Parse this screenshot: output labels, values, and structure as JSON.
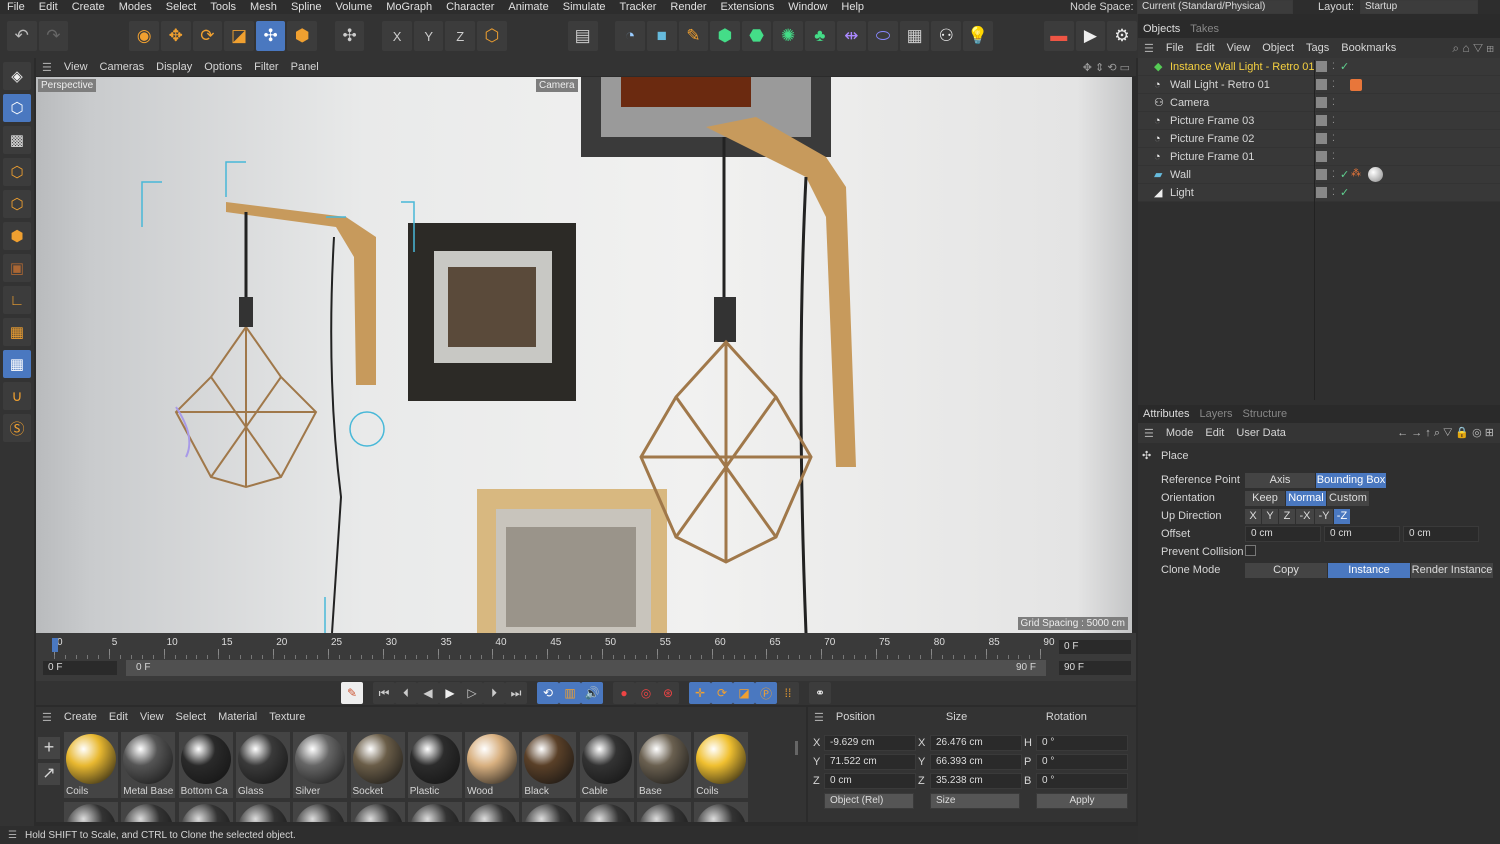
{
  "menu": [
    "File",
    "Edit",
    "Create",
    "Modes",
    "Select",
    "Tools",
    "Mesh",
    "Spline",
    "Volume",
    "MoGraph",
    "Character",
    "Animate",
    "Simulate",
    "Tracker",
    "Render",
    "Extensions",
    "Window",
    "Help"
  ],
  "node_space": {
    "label": "Node Space:",
    "value": "Current (Standard/Physical)"
  },
  "layout": {
    "label": "Layout:",
    "value": "Startup"
  },
  "viewport": {
    "menu": [
      "View",
      "Cameras",
      "Display",
      "Options",
      "Filter",
      "Panel"
    ],
    "view_name": "Perspective",
    "camera_label": "Camera",
    "grid_spacing": "Grid Spacing : 5000 cm"
  },
  "timeline": {
    "ticks": [
      "0",
      "5",
      "10",
      "15",
      "20",
      "25",
      "30",
      "35",
      "40",
      "45",
      "50",
      "55",
      "60",
      "65",
      "70",
      "75",
      "80",
      "85",
      "90"
    ],
    "current": "0 F",
    "start": "0 F",
    "range_start": "0 F",
    "range_end": "90 F",
    "end": "90 F"
  },
  "materials": {
    "menu": [
      "Create",
      "Edit",
      "View",
      "Select",
      "Material",
      "Texture"
    ],
    "items": [
      {
        "name": "Coils",
        "color": "#e8b830"
      },
      {
        "name": "Metal Base",
        "color": "#555"
      },
      {
        "name": "Bottom Ca",
        "color": "#2a2a2a"
      },
      {
        "name": "Glass",
        "color": "#3a3a3a"
      },
      {
        "name": "Silver",
        "color": "#666"
      },
      {
        "name": "Socket",
        "color": "#6a5d48"
      },
      {
        "name": "Plastic",
        "color": "#2c2c2c"
      },
      {
        "name": "Wood",
        "color": "#d8b080"
      },
      {
        "name": "Black",
        "color": "#5a4028"
      },
      {
        "name": "Cable",
        "color": "#333"
      },
      {
        "name": "Base",
        "color": "#6a6050"
      },
      {
        "name": "Coils",
        "color": "#f0c030"
      }
    ]
  },
  "coords": {
    "headers": [
      "Position",
      "Size",
      "Rotation"
    ],
    "rows": [
      {
        "a": "X",
        "p": "-9.629 cm",
        "b": "X",
        "s": "26.476 cm",
        "c": "H",
        "r": "0 °"
      },
      {
        "a": "Y",
        "p": "71.522 cm",
        "b": "Y",
        "s": "66.393 cm",
        "c": "P",
        "r": "0 °"
      },
      {
        "a": "Z",
        "p": "0 cm",
        "b": "Z",
        "s": "35.238 cm",
        "c": "B",
        "r": "0 °"
      }
    ],
    "mode": "Object (Rel)",
    "size_mode": "Size",
    "apply": "Apply"
  },
  "status": "Hold SHIFT to Scale, and CTRL to Clone the selected object.",
  "objects": {
    "tabs": [
      "Objects",
      "Takes"
    ],
    "menu": [
      "File",
      "Edit",
      "View",
      "Object",
      "Tags",
      "Bookmarks"
    ],
    "items": [
      {
        "name": "Instance Wall Light - Retro 01",
        "icon": "instance-icon",
        "selected": true
      },
      {
        "name": "Wall Light - Retro 01",
        "icon": "null-icon"
      },
      {
        "name": "Camera",
        "icon": "camera-icon"
      },
      {
        "name": "Picture Frame 03",
        "icon": "null-icon"
      },
      {
        "name": "Picture Frame 02",
        "icon": "null-icon"
      },
      {
        "name": "Picture Frame 01",
        "icon": "null-icon"
      },
      {
        "name": "Wall",
        "icon": "plane-icon"
      },
      {
        "name": "Light",
        "icon": "light-icon"
      }
    ]
  },
  "attributes": {
    "tabs": [
      "Attributes",
      "Layers",
      "Structure"
    ],
    "menu": [
      "Mode",
      "Edit",
      "User Data"
    ],
    "section": "Place",
    "reference_point": {
      "label": "Reference Point",
      "options": [
        "Axis",
        "Bounding Box"
      ],
      "selected": "Bounding Box"
    },
    "orientation": {
      "label": "Orientation",
      "options": [
        "Keep",
        "Normal",
        "Custom"
      ],
      "selected": "Normal"
    },
    "up_direction": {
      "label": "Up Direction",
      "options": [
        "X",
        "Y",
        "Z",
        "-X",
        "-Y",
        "-Z"
      ],
      "selected": "-Z"
    },
    "offset": {
      "label": "Offset",
      "values": [
        "0 cm",
        "0 cm",
        "0 cm"
      ]
    },
    "prevent_collision": {
      "label": "Prevent Collision",
      "checked": false
    },
    "clone_mode": {
      "label": "Clone Mode",
      "options": [
        "Copy",
        "Instance",
        "Render Instance"
      ],
      "selected": "Instance"
    }
  },
  "accent": "#4a78c0"
}
